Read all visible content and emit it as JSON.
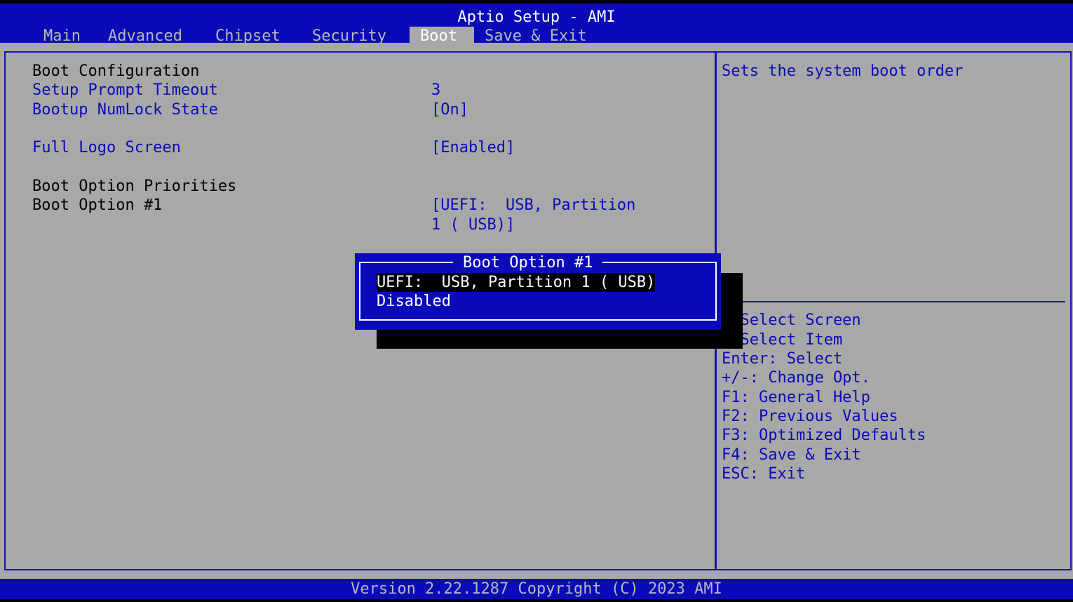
{
  "header": {
    "title": "Aptio Setup - AMI",
    "tabs": [
      {
        "label": "Main",
        "active": false
      },
      {
        "label": "Advanced",
        "active": false
      },
      {
        "label": "Chipset",
        "active": false
      },
      {
        "label": "Security",
        "active": false
      },
      {
        "label": "Boot",
        "active": true
      },
      {
        "label": "Save & Exit",
        "active": false
      }
    ]
  },
  "boot": {
    "section_config": "Boot Configuration",
    "setup_prompt_timeout": {
      "label": "Setup Prompt Timeout",
      "value": "3"
    },
    "bootup_numlock_state": {
      "label": "Bootup NumLock State",
      "value": "[On]"
    },
    "full_logo_screen": {
      "label": "Full Logo Screen",
      "value": "[Enabled]"
    },
    "section_priorities": "Boot Option Priorities",
    "boot_option_1": {
      "label": "Boot Option #1",
      "value_line1": "[UEFI:  USB, Partition",
      "value_line2": "1 ( USB)]"
    }
  },
  "help": {
    "description": "Sets the system boot order",
    "keys": [
      ": Select Screen",
      ": Select Item",
      "Enter: Select",
      "+/-: Change Opt.",
      "F1: General Help",
      "F2: Previous Values",
      "F3: Optimized Defaults",
      "F4: Save & Exit",
      "ESC: Exit"
    ]
  },
  "popup": {
    "title": "Boot Option #1",
    "options": [
      {
        "label": "UEFI:  USB, Partition 1 ( USB)",
        "selected": true
      },
      {
        "label": "Disabled",
        "selected": false
      }
    ]
  },
  "footer": {
    "version": "Version 2.22.1287 Copyright (C) 2023 AMI"
  },
  "colors": {
    "header_bg": "#0A0AB8",
    "main_bg": "#A8A8A8",
    "link_text": "#0A0AB8",
    "static_text": "#000000",
    "popup_bg": "#0A0AB8",
    "selected_bg": "#000000"
  }
}
